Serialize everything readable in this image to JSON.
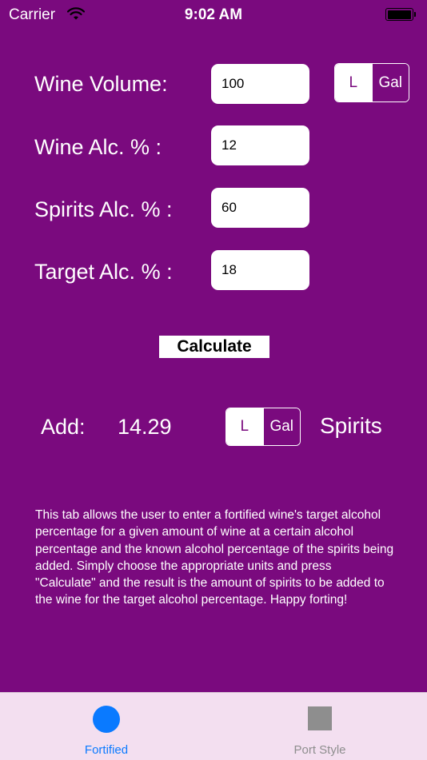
{
  "status_bar": {
    "carrier": "Carrier",
    "time": "9:02 AM"
  },
  "form": {
    "wine_volume_label": "Wine Volume:",
    "wine_volume_value": "100",
    "wine_alc_label": "Wine Alc. % :",
    "wine_alc_value": "12",
    "spirits_alc_label": "Spirits Alc. % :",
    "spirits_alc_value": "60",
    "target_alc_label": "Target Alc. % :",
    "target_alc_value": "18",
    "volume_unit": {
      "option_l": "L",
      "option_gal": "Gal",
      "selected": "L"
    }
  },
  "calculate_label": "Calculate",
  "result": {
    "add_label": "Add:",
    "value": "14.29",
    "unit": {
      "option_l": "L",
      "option_gal": "Gal",
      "selected": "L"
    },
    "suffix": "Spirits"
  },
  "info_text": "This tab allows the user to enter a fortified wine's target alcohol percentage for a given amount of wine at a certain alcohol percentage and the known alcohol percentage of the spirits being added. Simply choose the appropriate units and press \"Calculate\" and the result is the amount of spirits to be added to the wine for the target alcohol percentage.  Happy forting!",
  "tabs": [
    {
      "label": "Fortified",
      "active": true,
      "color": "#0a7aff"
    },
    {
      "label": "Port Style",
      "active": false,
      "color": "#8e8e8e"
    }
  ],
  "colors": {
    "background": "#7a0a7e",
    "accent": "#0a7aff",
    "tabbar": "#f3dff0"
  }
}
